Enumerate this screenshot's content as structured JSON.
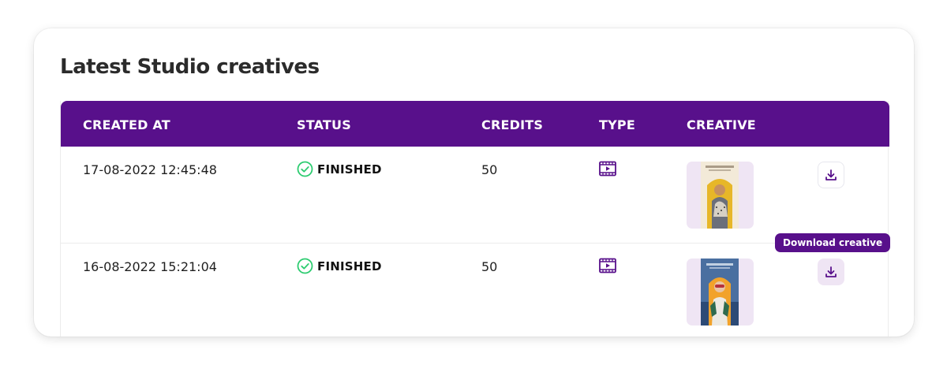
{
  "title": "Latest Studio creatives",
  "columns": {
    "created_at": "CREATED AT",
    "status": "STATUS",
    "credits": "CREDITS",
    "type": "TYPE",
    "creative": "CREATIVE"
  },
  "rows": [
    {
      "created_at": "17-08-2022 12:45:48",
      "status": "FINISHED",
      "credits": "50",
      "type_icon": "video-icon",
      "creative_icon": "creative-thumbnail",
      "download_icon": "download-icon"
    },
    {
      "created_at": "16-08-2022 15:21:04",
      "status": "FINISHED",
      "credits": "50",
      "type_icon": "video-icon",
      "creative_icon": "creative-thumbnail",
      "download_icon": "download-icon"
    }
  ],
  "tooltip": "Download creative",
  "colors": {
    "accent": "#58108b",
    "status_ok": "#2ecc71",
    "thumb_bg": "#efe5f4"
  }
}
